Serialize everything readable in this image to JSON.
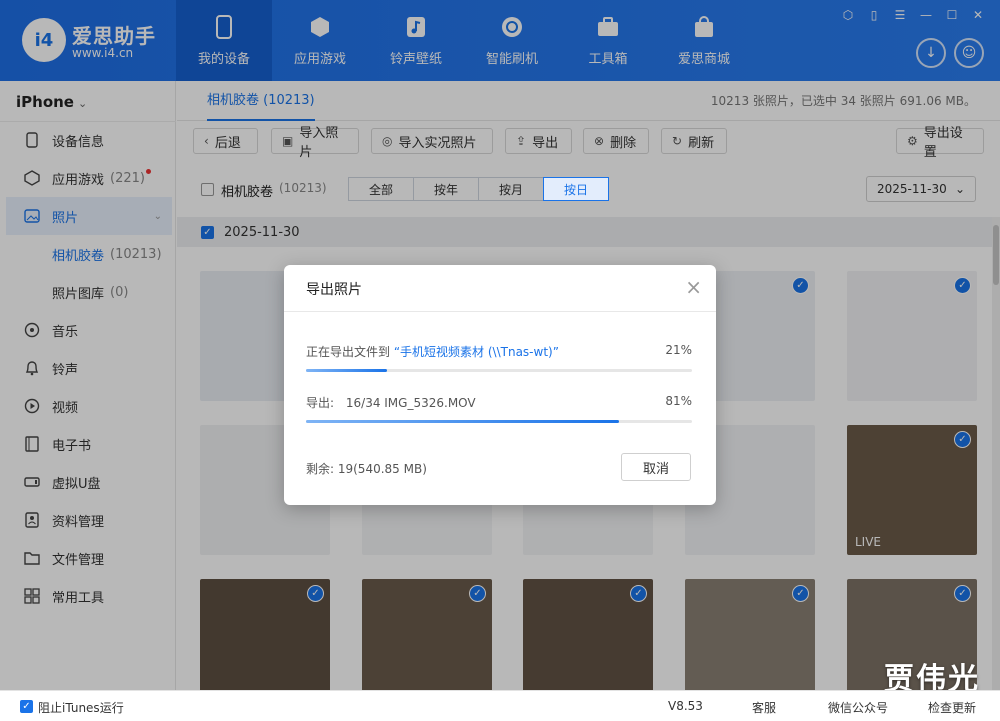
{
  "header": {
    "logo_text": "i4",
    "brand_name": "爱思助手",
    "brand_url": "www.i4.cn",
    "nav": [
      {
        "label": "我的设备",
        "icon": "phone-icon",
        "active": true
      },
      {
        "label": "应用游戏",
        "icon": "cube-icon",
        "active": false
      },
      {
        "label": "铃声壁纸",
        "icon": "music-icon",
        "active": false
      },
      {
        "label": "智能刷机",
        "icon": "refresh-gear-icon",
        "active": false
      },
      {
        "label": "工具箱",
        "icon": "toolbox-icon",
        "active": false
      },
      {
        "label": "爱思商城",
        "icon": "shopping-bag-icon",
        "active": false
      }
    ],
    "window_controls": [
      "shirt-icon",
      "pin-icon",
      "menu-icon",
      "minimize-icon",
      "maximize-icon",
      "close-icon"
    ]
  },
  "sidebar": {
    "device": "iPhone",
    "items": [
      {
        "label": "设备信息",
        "icon": "device-info-icon"
      },
      {
        "label": "应用游戏",
        "count": "(221)",
        "icon": "app-cube-icon",
        "badge": true
      },
      {
        "label": "照片",
        "icon": "photo-icon",
        "selected": true
      },
      {
        "label": "音乐",
        "icon": "music-note-icon"
      },
      {
        "label": "铃声",
        "icon": "bell-icon"
      },
      {
        "label": "视频",
        "icon": "video-play-icon"
      },
      {
        "label": "电子书",
        "icon": "book-icon"
      },
      {
        "label": "虚拟U盘",
        "icon": "usb-drive-icon"
      },
      {
        "label": "资料管理",
        "icon": "contacts-icon"
      },
      {
        "label": "文件管理",
        "icon": "folder-icon"
      },
      {
        "label": "常用工具",
        "icon": "grid-tools-icon"
      }
    ],
    "sub_items": [
      {
        "label": "相机胶卷",
        "count": "(10213)"
      },
      {
        "label": "照片图库",
        "count": "(0)"
      }
    ]
  },
  "main": {
    "tab": "相机胶卷 (10213)",
    "summary": "10213 张照片，已选中 34 张照片 691.06 MB。",
    "toolbar": [
      {
        "label": "后退",
        "icon": "back-arrow-icon"
      },
      {
        "label": "导入照片",
        "icon": "import-image-icon"
      },
      {
        "label": "导入实况照片",
        "icon": "live-photo-icon"
      },
      {
        "label": "导出",
        "icon": "export-icon"
      },
      {
        "label": "删除",
        "icon": "delete-icon"
      },
      {
        "label": "刷新",
        "icon": "refresh-icon"
      }
    ],
    "export_settings": "导出设置",
    "filter": {
      "album_label": "相机胶卷",
      "album_count": "(10213)",
      "segments": [
        "全部",
        "按年",
        "按月",
        "按日"
      ],
      "active_segment": "按日",
      "date": "2025-11-30"
    },
    "group_date": "2025-11-30",
    "live_label": "LIVE"
  },
  "dialog": {
    "title": "导出照片",
    "line1_prefix": "正在导出文件到",
    "line1_target": "“手机短视频素材 (\\\\Tnas-wt)”",
    "line1_percent": "21%",
    "line1_progress": 0.21,
    "line2_label": "导出:",
    "line2_file": "16/34 IMG_5326.MOV",
    "line2_percent": "81%",
    "line2_progress": 0.81,
    "remaining": "剩余: 19(540.85 MB)",
    "cancel": "取消"
  },
  "statusbar": {
    "block_itunes": "阻止iTunes运行",
    "version": "V8.53",
    "service": "客服",
    "wechat": "微信公众号",
    "update": "检查更新"
  },
  "watermark": "贾伟光"
}
